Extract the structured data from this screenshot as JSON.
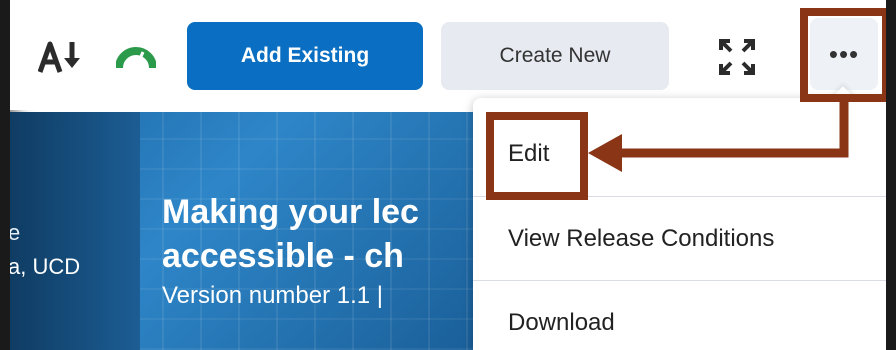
{
  "toolbar": {
    "add_existing_label": "Add Existing",
    "create_new_label": "Create New",
    "more_label": "•••",
    "icons": {
      "sort": "text-sort-icon",
      "progress": "speedometer-icon",
      "fullscreen": "expand-icon"
    },
    "accent_color": "#0a6fc2"
  },
  "banner": {
    "side_text_1": "e",
    "side_text_2": "a, UCD",
    "title_line_1": "Making your lec",
    "title_line_2": "accessible - ch",
    "subtitle": "Version number 1.1 |"
  },
  "menu": {
    "items": [
      {
        "label": "Edit"
      },
      {
        "label": "View Release Conditions"
      },
      {
        "label": "Download"
      }
    ]
  },
  "annotation": {
    "color": "#8a3515"
  }
}
